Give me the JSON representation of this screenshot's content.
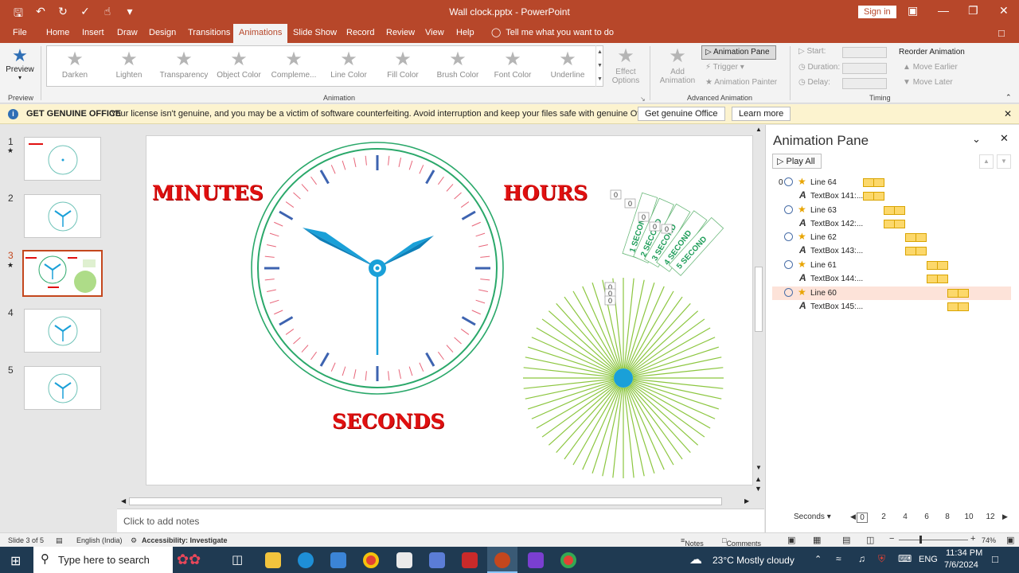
{
  "window": {
    "title": "Wall clock.pptx  -  PowerPoint",
    "sign_in": "Sign in"
  },
  "tabs": [
    {
      "label": "File"
    },
    {
      "label": "Home"
    },
    {
      "label": "Insert"
    },
    {
      "label": "Draw"
    },
    {
      "label": "Design"
    },
    {
      "label": "Transitions"
    },
    {
      "label": "Animations"
    },
    {
      "label": "Slide Show"
    },
    {
      "label": "Record"
    },
    {
      "label": "Review"
    },
    {
      "label": "View"
    },
    {
      "label": "Help"
    }
  ],
  "tell_me": "Tell me what you want to do",
  "ribbon": {
    "preview_label": "Preview",
    "preview_group": "Preview",
    "animation_group": "Animation",
    "advanced_group": "Advanced Animation",
    "timing_group": "Timing",
    "gallery": [
      {
        "label": "Darken"
      },
      {
        "label": "Lighten"
      },
      {
        "label": "Transparency"
      },
      {
        "label": "Object Color"
      },
      {
        "label": "Compleme..."
      },
      {
        "label": "Line Color"
      },
      {
        "label": "Fill Color"
      },
      {
        "label": "Brush Color"
      },
      {
        "label": "Font Color"
      },
      {
        "label": "Underline"
      }
    ],
    "effect_options": "Effect Options",
    "add_animation": "Add Animation",
    "animation_pane": "Animation Pane",
    "trigger": "Trigger",
    "animation_painter": "Animation Painter",
    "start": "Start:",
    "duration": "Duration:",
    "delay": "Delay:",
    "reorder": "Reorder Animation",
    "move_earlier": "Move Earlier",
    "move_later": "Move Later"
  },
  "genuine": {
    "heading": "GET GENUINE OFFICE",
    "message": "Your license isn't genuine, and you may be a victim of software counterfeiting. Avoid interruption and keep your files safe with genuine Office today.",
    "get_button": "Get genuine Office",
    "learn_button": "Learn more"
  },
  "slides": [
    {
      "number": "1",
      "has_animation": true
    },
    {
      "number": "2",
      "has_animation": false
    },
    {
      "number": "3",
      "has_animation": true,
      "active": true
    },
    {
      "number": "4",
      "has_animation": false
    },
    {
      "number": "5",
      "has_animation": false
    }
  ],
  "slide": {
    "minutes": "MINUTES",
    "hours": "HOURS",
    "seconds": "SECONDS",
    "cards": [
      "1 SECOND",
      "2 SECOND",
      "3 SECOND",
      "4 SECOND",
      "5 SECOND"
    ],
    "tag_zero": "0"
  },
  "notes_placeholder": "Click to add notes",
  "animation_pane": {
    "title": "Animation Pane",
    "play_all": "Play All",
    "first_index": "0",
    "items": [
      {
        "label": "Line 64"
      },
      {
        "label": "TextBox 141:..."
      },
      {
        "label": "Line 63"
      },
      {
        "label": "TextBox 142:..."
      },
      {
        "label": "Line 62"
      },
      {
        "label": "TextBox 143:..."
      },
      {
        "label": "Line 61"
      },
      {
        "label": "TextBox 144:..."
      },
      {
        "label": "Line 60",
        "selected": true
      },
      {
        "label": "TextBox 145:..."
      }
    ],
    "seconds_label": "Seconds",
    "ticks": [
      "0",
      "2",
      "4",
      "6",
      "8",
      "10",
      "12"
    ]
  },
  "status": {
    "slide": "Slide 3 of 5",
    "language": "English (India)",
    "accessibility": "Accessibility: Investigate",
    "notes": "Notes",
    "comments": "Comments",
    "zoom": "74%"
  },
  "taskbar": {
    "search": "Type here to search",
    "weather": "23°C  Mostly cloudy",
    "lang": "ENG",
    "time": "11:34 PM",
    "date": "7/6/2024"
  }
}
